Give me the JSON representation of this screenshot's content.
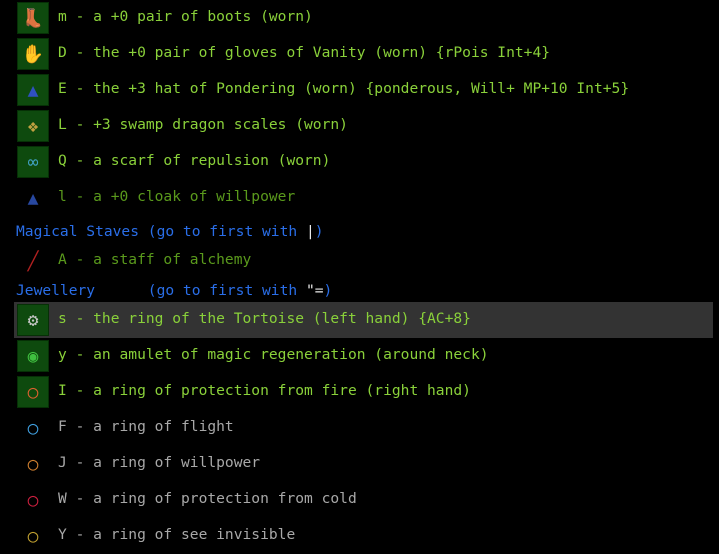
{
  "colors": {
    "worn": "#8ad13a",
    "carried": "#5a9a1c",
    "unidentified": "#a8a8a8",
    "header": "#2a6ee8",
    "selected_bg": "#333333"
  },
  "items_top": [
    {
      "icon": "boots-icon",
      "text": "m - a +0 pair of boots (worn)",
      "state": "worn"
    },
    {
      "icon": "gloves-icon",
      "text": "D - the +0 pair of gloves of Vanity (worn) {rPois Int+4}",
      "state": "worn"
    },
    {
      "icon": "hat-icon",
      "text": "E - the +3 hat of Pondering (worn) {ponderous, Will+ MP+10 Int+5}",
      "state": "worn"
    },
    {
      "icon": "dragon-scales-icon",
      "text": "L - +3 swamp dragon scales (worn)",
      "state": "worn"
    },
    {
      "icon": "scarf-icon",
      "text": "Q - a scarf of repulsion (worn)",
      "state": "worn"
    },
    {
      "icon": "cloak-icon",
      "text": "l - a +0 cloak of willpower",
      "state": "carried"
    }
  ],
  "staves_header": {
    "label": "Magical Staves (go to first with ",
    "key": "|",
    "close": ")"
  },
  "staff": {
    "icon": "staff-icon",
    "text": "A - a staff of alchemy",
    "state": "carried"
  },
  "jewellery_header": {
    "label": "Jewellery      (go to first with ",
    "key": "\"=",
    "close": ")"
  },
  "items_jewellery": [
    {
      "icon": "ring-icon",
      "text": "s - the ring of the Tortoise (left hand) {AC+8}",
      "state": "worn",
      "selected": true
    },
    {
      "icon": "amulet-icon",
      "text": "y - an amulet of magic regeneration (around neck)",
      "state": "worn"
    },
    {
      "icon": "ring-fire-icon",
      "text": "I - a ring of protection from fire (right hand)",
      "state": "worn"
    },
    {
      "icon": "ring-flight-icon",
      "text": "F - a ring of flight",
      "state": "unidentified"
    },
    {
      "icon": "ring-willpower-icon",
      "text": "J - a ring of willpower",
      "state": "unidentified"
    },
    {
      "icon": "ring-cold-icon",
      "text": "W - a ring of protection from cold",
      "state": "unidentified"
    },
    {
      "icon": "ring-see-invisible-icon",
      "text": "Y - a ring of see invisible",
      "state": "unidentified"
    }
  ]
}
